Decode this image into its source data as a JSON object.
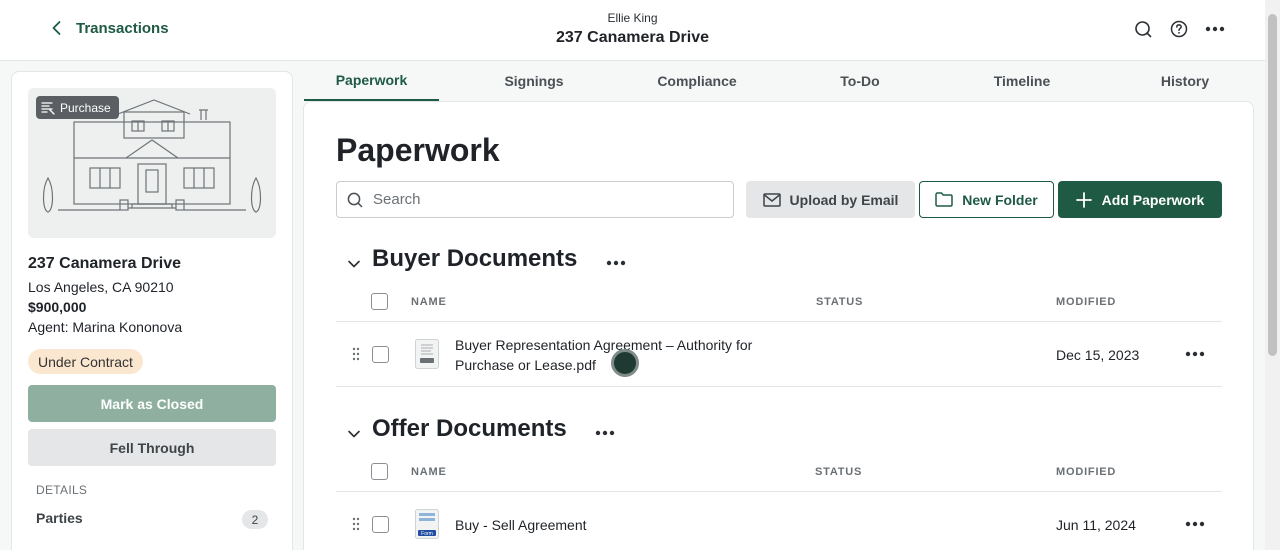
{
  "header": {
    "back_label": "Transactions",
    "agent_name": "Ellie King",
    "property_title": "237 Canamera Drive",
    "icons": [
      "search-icon",
      "help-icon",
      "more-icon"
    ]
  },
  "sidebar": {
    "badge": "Purchase",
    "address_title": "237 Canamera Drive",
    "address_line": "Los Angeles, CA 90210",
    "price": "$900,000",
    "agent": "Agent: Marina Kononova",
    "status": "Under Contract",
    "mark_closed_label": "Mark as Closed",
    "fell_through_label": "Fell Through",
    "details_label": "DETAILS",
    "parties_label": "Parties",
    "parties_count": "2"
  },
  "tabs": [
    {
      "label": "Paperwork",
      "active": true
    },
    {
      "label": "Signings",
      "active": false
    },
    {
      "label": "Compliance",
      "active": false
    },
    {
      "label": "To-Do",
      "active": false
    },
    {
      "label": "Timeline",
      "active": false
    },
    {
      "label": "History",
      "active": false
    }
  ],
  "main": {
    "title": "Paperwork",
    "search_placeholder": "Search",
    "upload_email_label": "Upload by Email",
    "new_folder_label": "New Folder",
    "add_paperwork_label": "Add Paperwork",
    "columns": {
      "name": "NAME",
      "status": "STATUS",
      "modified": "MODIFIED"
    },
    "sections": [
      {
        "title": "Buyer Documents",
        "documents": [
          {
            "name": "Buyer Representation Agreement – Authority for Purchase or Lease.pdf",
            "status": "",
            "modified": "Dec 15, 2023",
            "icon": "pdf-doc-icon"
          }
        ]
      },
      {
        "title": "Offer Documents",
        "documents": [
          {
            "name": "Buy - Sell Agreement",
            "status": "",
            "modified": "Jun 11, 2024",
            "icon": "form-doc-icon",
            "icon_text": "Form"
          }
        ]
      }
    ]
  },
  "colors": {
    "brand_green": "#1e5a44",
    "status_chip_bg": "#fbe7cf",
    "mark_closed_bg": "#8fb0a0"
  }
}
